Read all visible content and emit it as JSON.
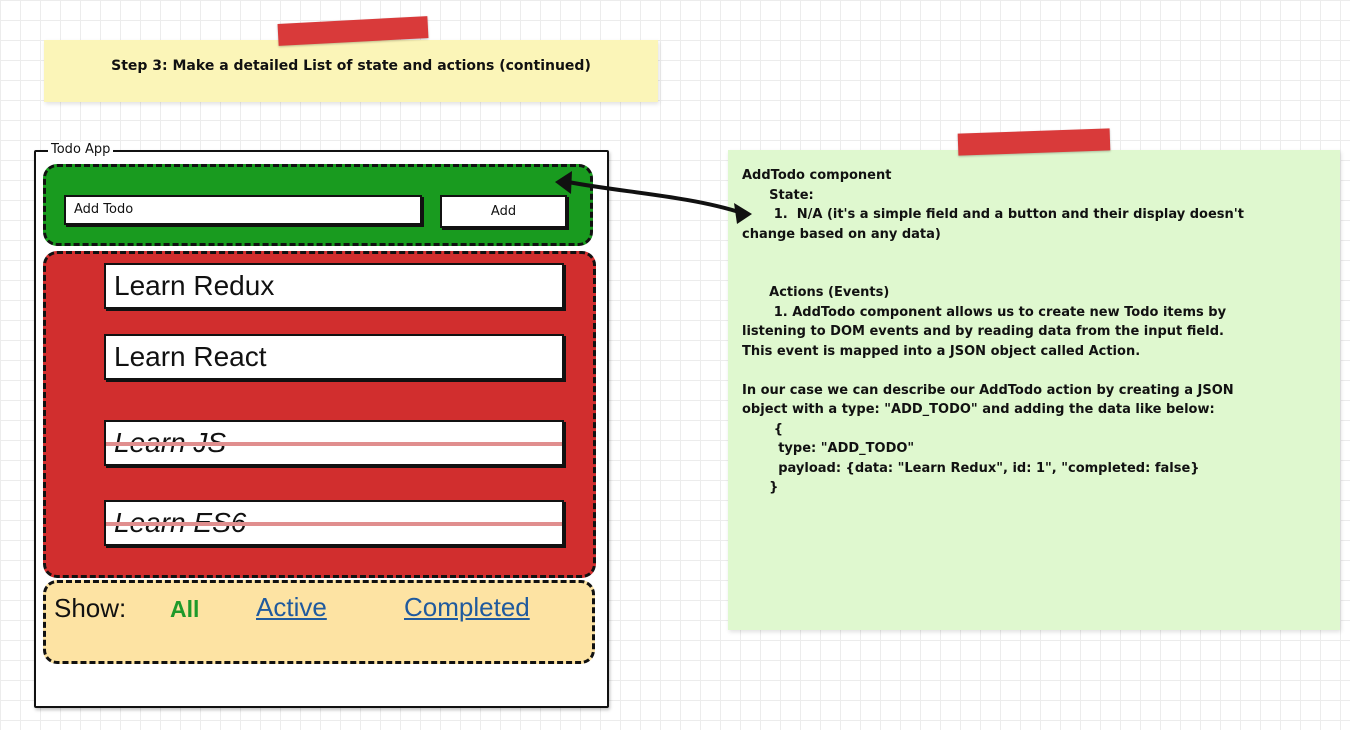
{
  "step_note": {
    "title": "Step 3: Make a detailed List of state and actions (continued)"
  },
  "todo_app": {
    "frame_title": "Todo App",
    "add_placeholder": "Add Todo",
    "add_button": "Add",
    "todos": [
      {
        "text": "Learn Redux",
        "completed": false
      },
      {
        "text": "Learn React",
        "completed": false
      },
      {
        "text": "Learn JS",
        "completed": true
      },
      {
        "text": "Learn ES6",
        "completed": true
      }
    ],
    "filters": {
      "label": "Show:",
      "all": "All",
      "active": "Active",
      "completed": "Completed"
    }
  },
  "explanation_note": {
    "text": "AddTodo component\n      State:\n       1.  N/A (it's a simple field and a button and their display doesn't\nchange based on any data)\n\n\n      Actions (Events)\n       1. AddTodo component allows us to create new Todo items by\nlistening to DOM events and by reading data from the input field.\nThis event is mapped into a JSON object called Action.\n\nIn our case we can describe our AddTodo action by creating a JSON\nobject with a type: \"ADD_TODO\" and adding the data like below:\n       {\n        type: \"ADD_TODO\"\n        payload: {data: \"Learn Redux\", id: 1\", \"completed: false}\n      }"
  },
  "colors": {
    "green_region": "#199b1f",
    "red_region": "#d12e2e",
    "yellow_region": "#fde3a3",
    "sticky_yellow": "#fbf5b8",
    "sticky_green": "#dff8cf",
    "tape": "#d93a3a",
    "link": "#1f5a9e",
    "active_filter": "#1f9a2a"
  }
}
